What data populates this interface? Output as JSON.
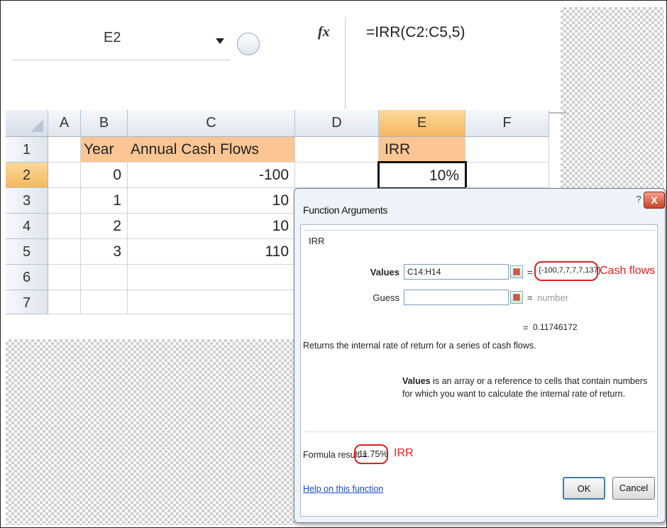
{
  "name_box": "E2",
  "formula": "=IRR(C2:C5,5)",
  "fx_label": "fx",
  "columns": [
    "A",
    "B",
    "C",
    "D",
    "E",
    "F"
  ],
  "rows": [
    {
      "num": "1",
      "B": "Year",
      "C": "Annual Cash Flows",
      "E": "IRR"
    },
    {
      "num": "2",
      "B": "0",
      "C": "-100",
      "E": "10%"
    },
    {
      "num": "3",
      "B": "1",
      "C": "10"
    },
    {
      "num": "4",
      "B": "2",
      "C": "10"
    },
    {
      "num": "5",
      "B": "3",
      "C": "110"
    },
    {
      "num": "6"
    },
    {
      "num": "7"
    }
  ],
  "dialog": {
    "title": "Function Arguments",
    "help_glyph": "?",
    "close_glyph": "X",
    "function_name": "IRR",
    "values_label": "Values",
    "values_input": "C14:H14",
    "values_result": "{-100,7,7,7,7,137}",
    "values_note": "Cash flows",
    "guess_label": "Guess",
    "guess_input": "",
    "guess_hint": "number",
    "equals": "=",
    "calc_result": "0.11746172",
    "description": "Returns the internal rate of return for a series of cash flows.",
    "values_desc_label": "Values",
    "values_desc": "is an array or a reference to cells that contain numbers for which you want to calculate the internal rate of return.",
    "formula_result_label": "Formula result =",
    "formula_result": "11.75%",
    "formula_result_note": "IRR",
    "help_link": "Help on this function",
    "ok_label": "OK",
    "cancel_label": "Cancel"
  },
  "colors": {
    "highlight": "#fbc693",
    "annotation": "#e02020",
    "link": "#1a47c9"
  }
}
